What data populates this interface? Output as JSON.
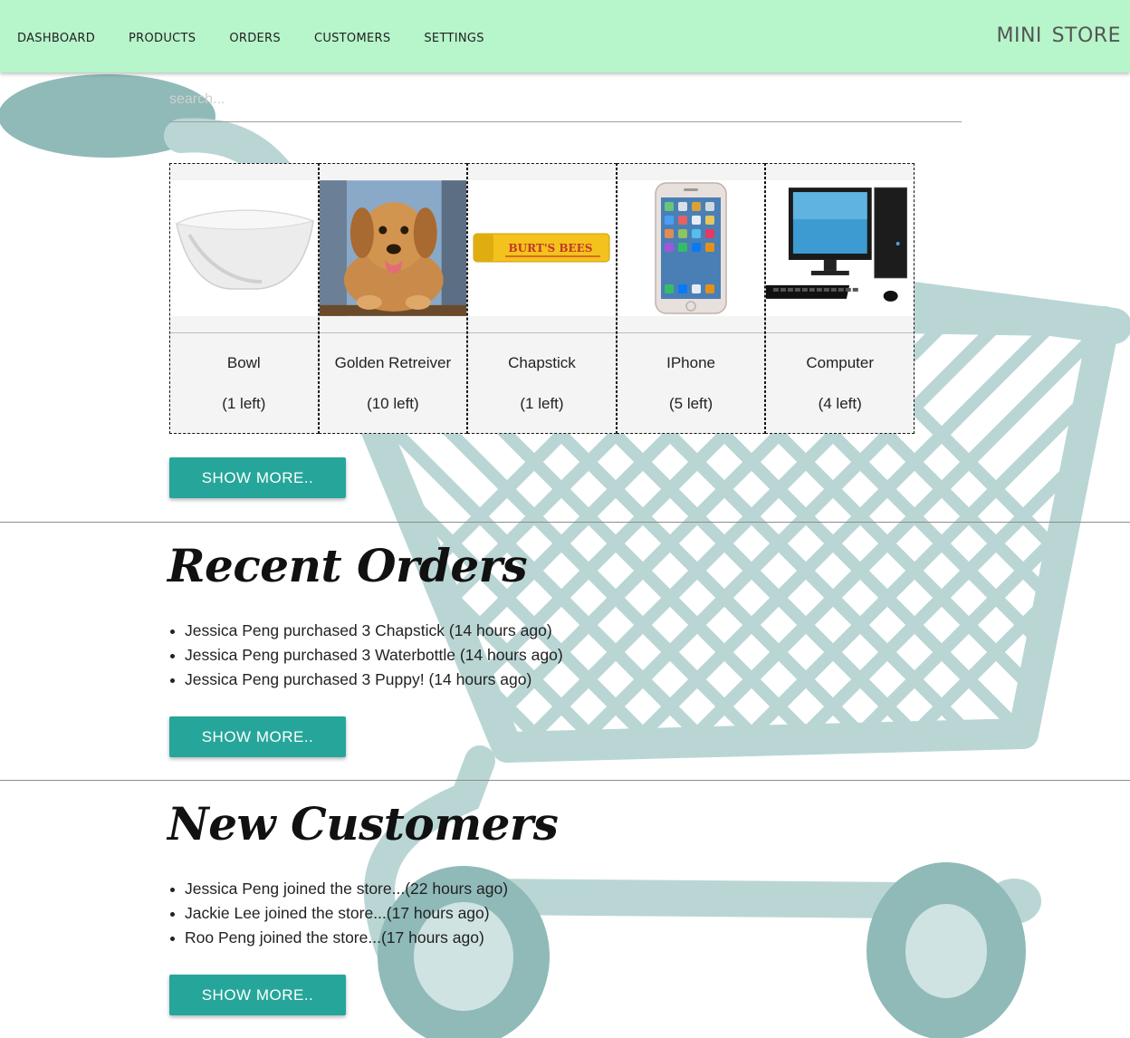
{
  "nav": {
    "links": [
      "dashboard",
      "products",
      "orders",
      "customers",
      "settings"
    ],
    "brand": "mini store"
  },
  "search": {
    "placeholder": "search...",
    "value": ""
  },
  "products": [
    {
      "name": "Bowl",
      "stock": "(1 left)",
      "icon": "bowl-image"
    },
    {
      "name": "Golden Retreiver",
      "stock": "(10 left)",
      "icon": "dog-image"
    },
    {
      "name": "Chapstick",
      "stock": "(1 left)",
      "icon": "chapstick-image",
      "image_text": "BURT'S BEES"
    },
    {
      "name": "IPhone",
      "stock": "(5 left)",
      "icon": "phone-image"
    },
    {
      "name": "Computer",
      "stock": "(4 left)",
      "icon": "computer-image"
    }
  ],
  "buttons": {
    "show_more": "SHOW MORE.."
  },
  "recent_orders": {
    "title": "Recent Orders",
    "items": [
      "Jessica Peng purchased 3 Chapstick (14 hours ago)",
      "Jessica Peng purchased 3 Waterbottle (14 hours ago)",
      "Jessica Peng purchased 3 Puppy! (14 hours ago)"
    ]
  },
  "new_customers": {
    "title": "New Customers",
    "items": [
      "Jessica Peng joined the store...(22 hours ago)",
      "Jackie Lee joined the store...(17 hours ago)",
      "Roo Peng joined the store...(17 hours ago)"
    ]
  },
  "colors": {
    "navbar": "#b7f5cb",
    "button": "#26a69a",
    "cart_light": "#b9d6d5",
    "cart_dark": "#8fbab8"
  }
}
